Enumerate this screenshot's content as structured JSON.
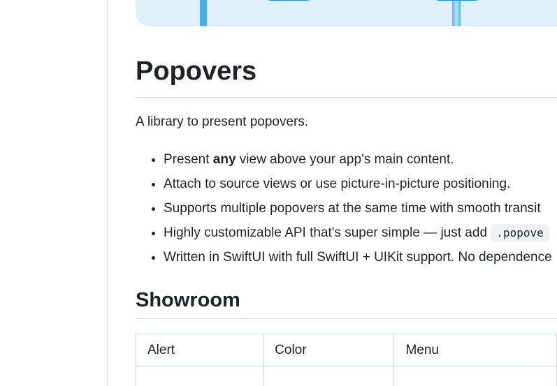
{
  "readme": {
    "title": "Popovers",
    "intro": "A library to present popovers.",
    "features": [
      {
        "before": "Present ",
        "bold": "any",
        "after": " view above your app's main content."
      },
      {
        "text": "Attach to source views or use picture-in-picture positioning."
      },
      {
        "text": "Supports multiple popovers at the same time with smooth transit"
      },
      {
        "text": "Highly customizable API that's super simple — just add ",
        "code": ".popove"
      },
      {
        "text": "Written in SwiftUI with full SwiftUI + UIKit support. No dependence"
      }
    ],
    "showroom": {
      "heading": "Showroom",
      "columns": [
        "Alert",
        "Color",
        "Menu"
      ]
    }
  },
  "colors": {
    "banner_bg": "#dff0fb",
    "banner_accent": "#3fb1f3",
    "text": "#1f2328",
    "rule": "#d8dee4"
  }
}
